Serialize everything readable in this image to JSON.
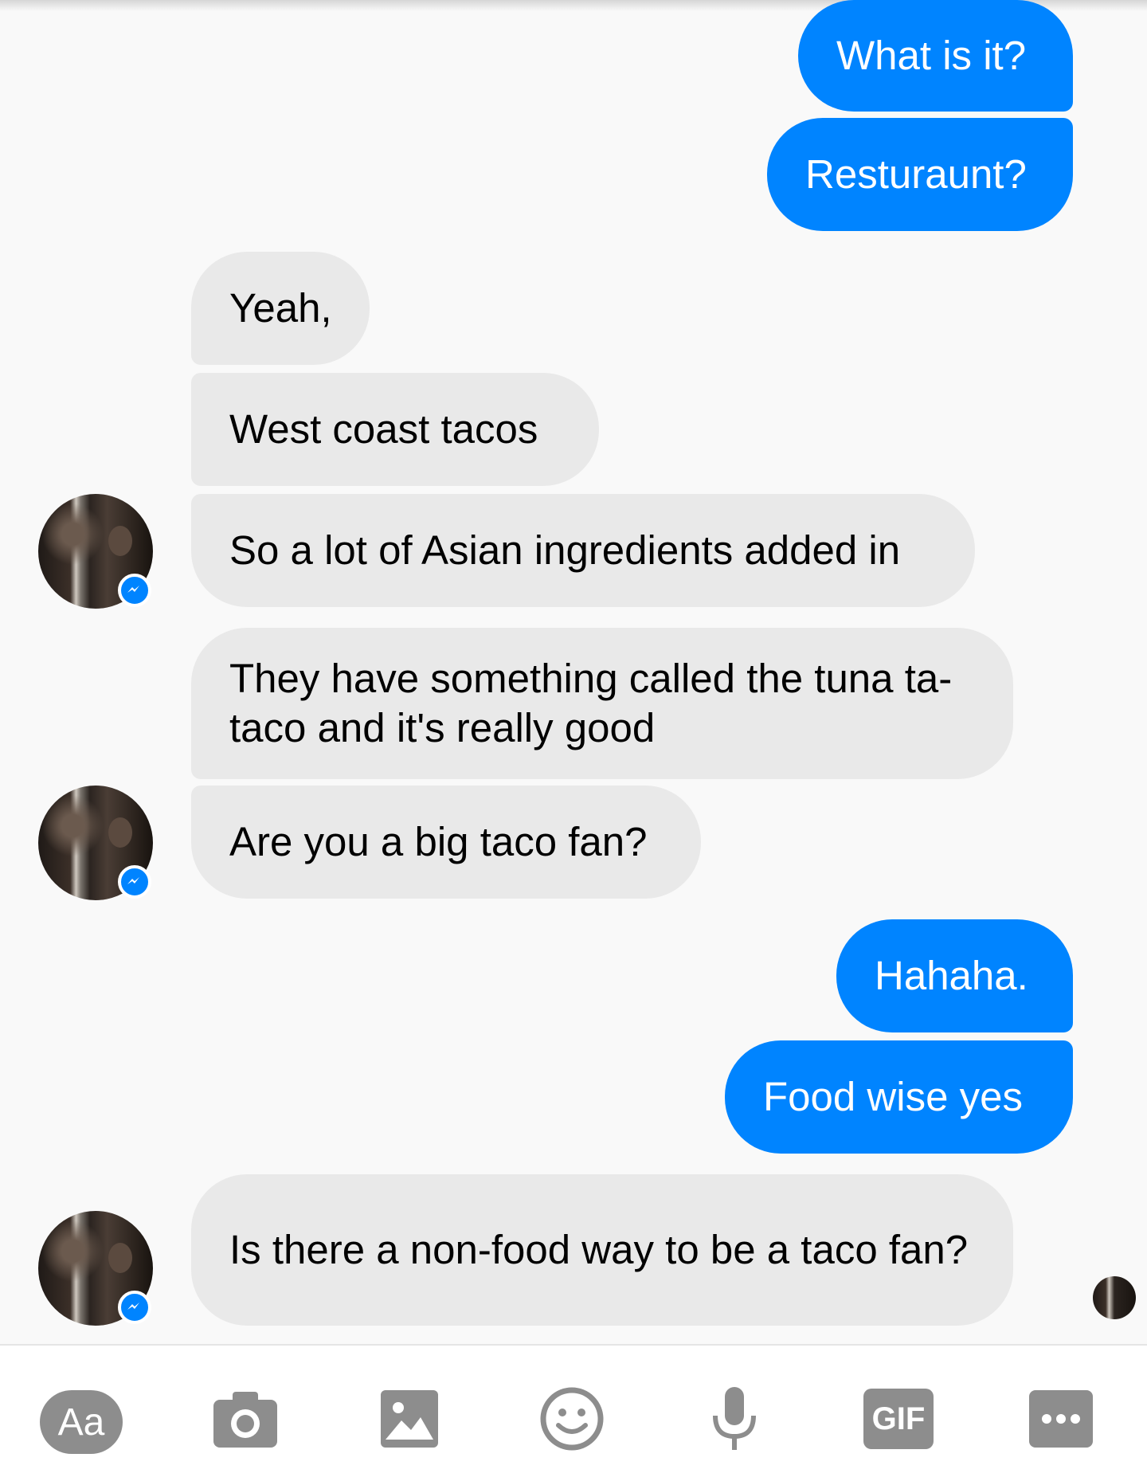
{
  "messages": [
    {
      "from": "me",
      "text": "What is it?"
    },
    {
      "from": "me",
      "text": "Resturaunt?"
    },
    {
      "from": "them",
      "text": "Yeah,"
    },
    {
      "from": "them",
      "text": "West coast tacos"
    },
    {
      "from": "them",
      "text": "So a lot of Asian ingredients added in"
    },
    {
      "from": "them",
      "text": "They have something called the tuna ta-taco and it's really good"
    },
    {
      "from": "them",
      "text": "Are you a big taco fan?"
    },
    {
      "from": "me",
      "text": "Hahaha."
    },
    {
      "from": "me",
      "text": "Food wise yes"
    },
    {
      "from": "them",
      "text": "Is there a non-food way to be a taco fan?"
    }
  ],
  "composer": {
    "text_button_label": "Aa",
    "tools": [
      "text-button",
      "camera-icon",
      "gallery-icon",
      "emoji-icon",
      "microphone-icon",
      "gif-button",
      "more-icon"
    ],
    "gif_label": "GIF"
  },
  "colors": {
    "outgoing": "#0084ff",
    "incoming": "#e9e9e9",
    "background": "#f9f9f9",
    "icon_gray": "#8d8d8d"
  }
}
